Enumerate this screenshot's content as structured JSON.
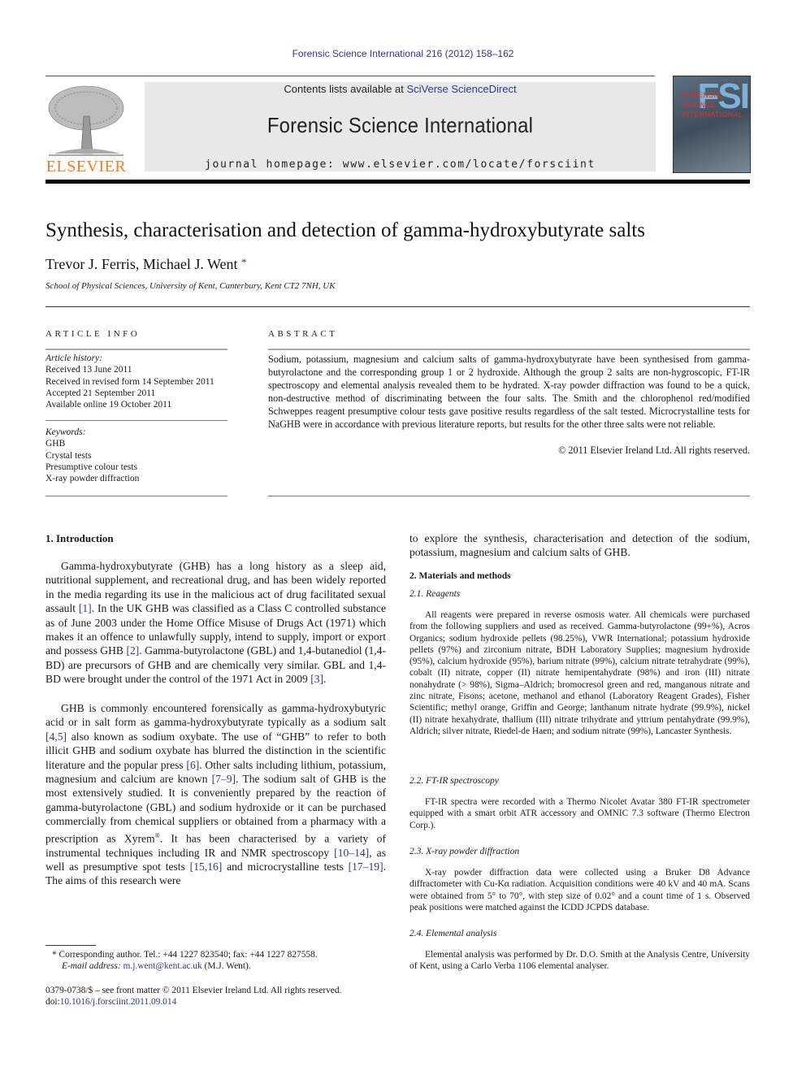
{
  "header": {
    "running_head": "Forensic Science International 216 (2012) 158–162",
    "contents_prefix": "Contents lists available at ",
    "contents_link": "SciVerse ScienceDirect",
    "journal_title": "Forensic Science International",
    "homepage_label": "journal homepage: www.elsevier.com/locate/forsciint",
    "publisher_logo_text": "ELSEVIER",
    "cover": {
      "letters": "FSI",
      "lines": [
        "FORENSIC",
        "SCIENCE",
        "INTERNATIONAL"
      ]
    }
  },
  "article": {
    "title": "Synthesis, characterisation and detection of gamma-hydroxybutyrate salts",
    "authors": "Trevor J. Ferris, Michael J. Went",
    "author_mark": "*",
    "affiliation": "School of Physical Sciences, University of Kent, Canterbury, Kent CT2 7NH, UK"
  },
  "article_info": {
    "heading": "ARTICLE INFO",
    "history_label": "Article history:",
    "history": [
      "Received 13 June 2011",
      "Received in revised form 14 September 2011",
      "Accepted 21 September 2011",
      "Available online 19 October 2011"
    ],
    "keywords_label": "Keywords:",
    "keywords": [
      "GHB",
      "Crystal tests",
      "Presumptive colour tests",
      "X-ray powder diffraction"
    ]
  },
  "abstract": {
    "heading": "ABSTRACT",
    "text": "Sodium, potassium, magnesium and calcium salts of gamma-hydroxybutyrate have been synthesised from gamma-butyrolactone and the corresponding group 1 or 2 hydroxide. Although the group 2 salts are non-hygroscopic, FT-IR spectroscopy and elemental analysis revealed them to be hydrated. X-ray powder diffraction was found to be a quick, non-destructive method of discriminating between the four salts. The Smith and the chlorophenol red/modified Schweppes reagent presumptive colour tests gave positive results regardless of the salt tested. Microcrystalline tests for NaGHB were in accordance with previous literature reports, but results for the other three salts were not reliable.",
    "copyright": "© 2011 Elsevier Ireland Ltd. All rights reserved."
  },
  "intro": {
    "heading": "1.  Introduction",
    "p1": [
      "Gamma-hydroxybutyrate (GHB) has a long history as a sleep aid, nutritional supplement, and recreational drug, and has been widely reported in the media regarding its use in the malicious act of drug facilitated sexual assault ",
      "[1]",
      ". In the UK GHB was classified as a Class C controlled substance as of June 2003 under the Home Office Misuse of Drugs Act (1971) which makes it an offence to unlawfully supply, intend to supply, import or export and possess GHB ",
      "[2]",
      ". Gamma-butyrolactone (GBL) and 1,4-butanediol (1,4-BD) are precursors of GHB and are chemically very similar. GBL and 1,4-BD were brought under the control of the 1971 Act in 2009 ",
      "[3]",
      "."
    ],
    "p2": [
      "GHB is commonly encountered forensically as gamma-hydroxybutyric acid or in salt form as gamma-hydroxybutyrate typically as a sodium salt ",
      "[4,5]",
      " also known as sodium oxybate. The use of “GHB” to refer to both illicit GHB and sodium oxybate has blurred the distinction in the scientific literature and the popular press ",
      "[6]",
      ". Other salts including lithium, potassium, magnesium and calcium are known ",
      "[7–9]",
      ". The sodium salt of GHB is the most extensively studied. It is conveniently prepared by the reaction of gamma-butyrolactone (GBL) and sodium hydroxide or it can be purchased commercially from chemical suppliers or obtained from a pharmacy with a prescription as Xyrem",
      "®",
      ". It has been characterised by a variety of instrumental techniques including IR and NMR spectroscopy ",
      "[10–14]",
      ", as well as presumptive spot tests ",
      "[15,16]",
      " and microcrystalline tests ",
      "[17–19]",
      ". The aims of this research were"
    ],
    "continued": "to explore the synthesis, characterisation and detection of the sodium, potassium, magnesium and calcium salts of GHB."
  },
  "methods": {
    "heading": "2.  Materials and methods",
    "s21_heading": "2.1.  Reagents",
    "s21_text": "All reagents were prepared in reverse osmosis water. All chemicals were purchased from the following suppliers and used as received. Gamma-butyrolactone (99+%), Acros Organics; sodium hydroxide pellets (98.25%), VWR International; potassium hydroxide pellets (97%) and zirconium nitrate, BDH Laboratory Supplies; magnesium hydroxide (95%), calcium hydroxide (95%), barium nitrate (99%), calcium nitrate tetrahydrate (99%), cobalt (II) nitrate, copper (II) nitrate hemipentahydrate (98%) and iron (III) nitrate nonahydrate (> 98%), Sigma–Aldrich; bromocresol green and red, manganous nitrate and zinc nitrate, Fisons; acetone, methanol and ethanol (Laboratory Reagent Grades), Fisher Scientific; methyl orange, Griffin and George; lanthanum nitrate hydrate (99.9%), nickel (II) nitrate hexahydrate, thallium (III) nitrate trihydrate and yttrium pentahydrate (99.9%), Aldrich; silver nitrate, Riedel-de Haen; and sodium nitrate (99%), Lancaster Synthesis.",
    "s22_heading": "2.2.  FT-IR spectroscopy",
    "s22_text": "FT-IR spectra were recorded with a Thermo Nicolet Avatar 380 FT-IR spectrometer equipped with a smart orbit ATR accessory and OMNIC 7.3 software (Thermo Electron Corp.).",
    "s23_heading": "2.3.  X-ray powder diffraction",
    "s23_text": "X-ray powder diffraction data were collected using a Bruker D8 Advance diffractometer with Cu-Kα radiation. Acquisition conditions were 40 kV and 40 mA. Scans were obtained from 5° to 70°, with step size of 0.02° and a count time of 1 s. Observed peak positions were matched against the ICDD JCPDS database.",
    "s24_heading": "2.4.  Elemental analysis",
    "s24_text": "Elemental analysis was performed by Dr. D.O. Smith at the Analysis Centre, University of Kent, using a Carlo Verba 1106 elemental analyser."
  },
  "footnotes": {
    "corresponding": "Corresponding author. Tel.: +44 1227 823540; fax: +44 1227 827558.",
    "email_label": "E-mail address: ",
    "email": "m.j.went@kent.ac.uk",
    "email_suffix": " (M.J. Went).",
    "front_matter": "0379-0738/$ – see front matter © 2011 Elsevier Ireland Ltd. All rights reserved.",
    "doi_prefix": "doi:",
    "doi": "10.1016/j.forsciint.2011.09.014"
  }
}
